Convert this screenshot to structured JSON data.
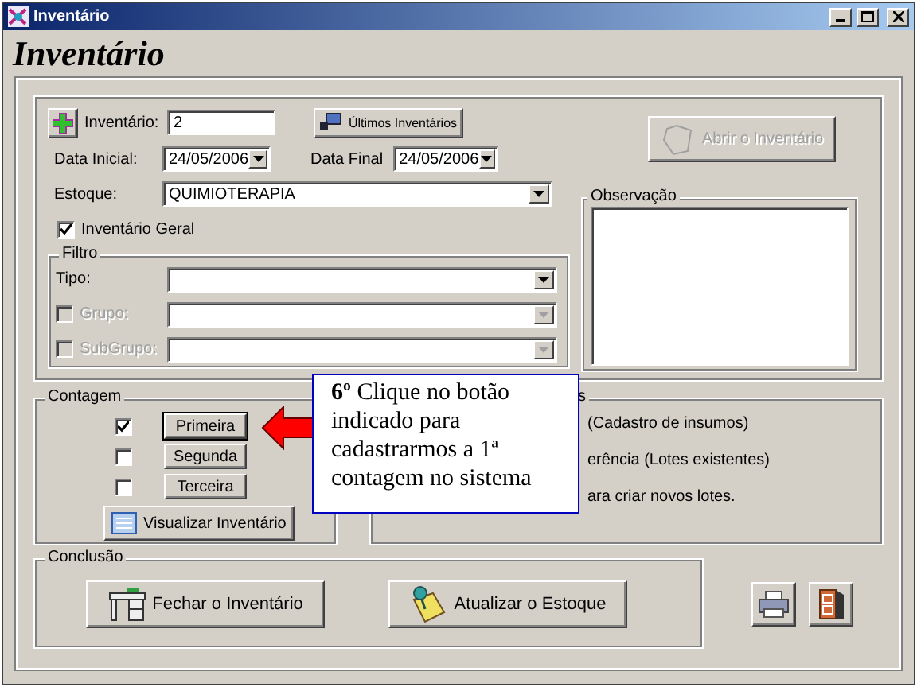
{
  "window": {
    "title": "Inventário"
  },
  "heading": "Inventário",
  "inventory": {
    "label": "Inventário:",
    "value": "2"
  },
  "last_inventories_button": {
    "label": "Últimos Inventários"
  },
  "start_date": {
    "label": "Data Inicial:",
    "value": "24/05/2006"
  },
  "end_date": {
    "label": "Data Final",
    "value": "24/05/2006"
  },
  "stock": {
    "label": "Estoque:",
    "value": "QUIMIOTERAPIA"
  },
  "general_inventory": {
    "label": "Inventário Geral",
    "checked": true
  },
  "open_button": {
    "label": "Abrir o Inventário",
    "disabled": true
  },
  "observation": {
    "title": "Observação"
  },
  "filter": {
    "title": "Filtro",
    "fields": [
      {
        "kind": "plain",
        "label": "Tipo:",
        "disabled": false
      },
      {
        "kind": "checkbox",
        "label": "Grupo:",
        "checked": false,
        "disabled": true
      },
      {
        "kind": "checkbox",
        "label": "SubGrupo:",
        "checked": false,
        "disabled": true
      }
    ]
  },
  "counting": {
    "title": "Contagem",
    "rows": [
      {
        "label": "Primeira",
        "checked": true,
        "selected": true
      },
      {
        "label": "Segunda",
        "checked": false,
        "selected": false
      },
      {
        "label": "Terceira",
        "checked": false,
        "selected": false
      }
    ],
    "view_button": {
      "label": "Visualizar Inventário"
    }
  },
  "side_group": {
    "title": "s",
    "lines": [
      "(Cadastro de insumos)",
      "erência (Lotes existentes)",
      "ara criar novos lotes."
    ]
  },
  "conclusion": {
    "title": "Conclusão",
    "buttons": [
      {
        "kind": "desk",
        "label": "Fechar o Inventário"
      },
      {
        "kind": "note",
        "label": "Atualizar o Estoque"
      }
    ]
  },
  "tools": [
    {
      "kind": "print"
    },
    {
      "kind": "exit"
    }
  ],
  "callout": {
    "text": "**6º** Clique no botão indicado para cadastrarmos a 1ª contagem no sistema"
  }
}
